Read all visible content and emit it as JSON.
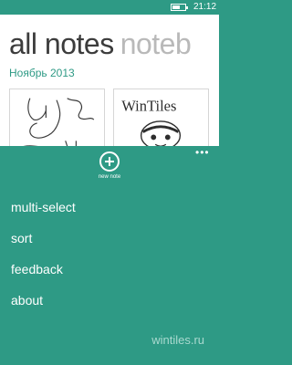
{
  "status_bar": {
    "time": "21:12"
  },
  "page": {
    "title": "all notes",
    "next_pivot": "noteb"
  },
  "section": {
    "month": "Ноябрь 2013"
  },
  "notes": [
    {
      "kind": "handwriting-sketch"
    },
    {
      "kind": "wintiles-sketch",
      "text": "WinTiles"
    }
  ],
  "app_bar": {
    "new_note_label": "new note",
    "menu_items": [
      "multi-select",
      "sort",
      "feedback",
      "about"
    ]
  },
  "watermark": "wintiles.ru",
  "colors": {
    "accent": "#2e9a85",
    "background": "#ffffff",
    "title": "#3c3c3c"
  }
}
